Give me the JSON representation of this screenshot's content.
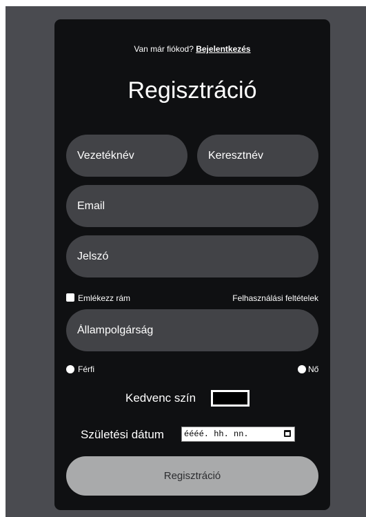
{
  "form": {
    "login_prompt": "Van már fiókod?",
    "login_link": "Bejelentkezés",
    "title": "Regisztráció",
    "last_name_placeholder": "Vezetéknév",
    "first_name_placeholder": "Keresztnév",
    "email_placeholder": "Email",
    "password_placeholder": "Jelszó",
    "remember_label": "Emlékezz rám",
    "terms_label": "Felhasználási feltételek",
    "citizenship_placeholder": "Állampolgárság",
    "gender_male": "Férfi",
    "gender_female": "Nő",
    "favorite_color_label": "Kedvenc szín",
    "favorite_color_value": "#000000",
    "birth_date_label": "Születési dátum",
    "birth_date_placeholder": "éééé. hh. nn.",
    "submit_label": "Regisztráció"
  },
  "colors": {
    "page_background": "#4a4b50",
    "card_background": "#0f1012",
    "field_background": "#424347",
    "submit_background": "#a9aaab"
  }
}
